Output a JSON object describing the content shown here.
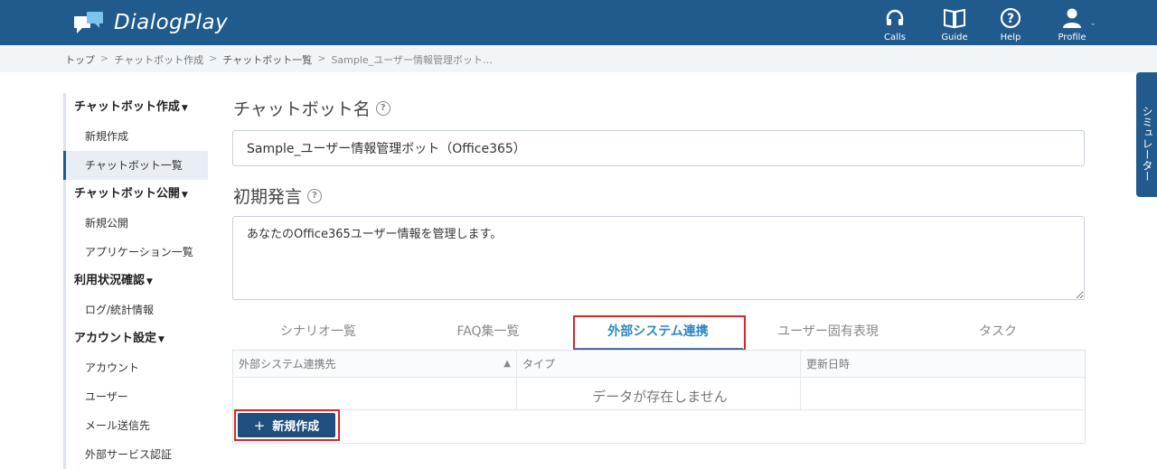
{
  "header": {
    "app_name": "DialogPlay",
    "nav": [
      {
        "id": "calls",
        "label": "Calls",
        "icon": "headset-icon"
      },
      {
        "id": "guide",
        "label": "Guide",
        "icon": "book-icon"
      },
      {
        "id": "help",
        "label": "Help",
        "icon": "question-icon"
      },
      {
        "id": "profile",
        "label": "Profile",
        "icon": "user-icon"
      }
    ],
    "profile_caret": "⌄"
  },
  "breadcrumb": {
    "items": [
      "トップ",
      "チャットボット作成",
      "チャットボット一覧",
      "Sample_ユーザー情報管理ボット…"
    ],
    "separator": ">"
  },
  "sidebar": {
    "groups": [
      {
        "title": "チャットボット作成",
        "items": [
          "新規作成",
          "チャットボット一覧"
        ]
      },
      {
        "title": "チャットボット公開",
        "items": [
          "新規公開",
          "アプリケーション一覧"
        ]
      },
      {
        "title": "利用状況確認",
        "items": [
          "ログ/統計情報"
        ]
      },
      {
        "title": "アカウント設定",
        "items": [
          "アカウント",
          "ユーザー",
          "メール送信先",
          "外部サービス認証"
        ]
      }
    ],
    "active_item": "チャットボット一覧"
  },
  "form": {
    "name_label": "チャットボット名",
    "name_value": "Sample_ユーザー情報管理ボット（Office365）",
    "greeting_label": "初期発言",
    "greeting_value": "あなたのOffice365ユーザー情報を管理します。",
    "help_glyph": "?"
  },
  "tabs": {
    "items": [
      "シナリオ一覧",
      "FAQ集一覧",
      "外部システム連携",
      "ユーザー固有表現",
      "タスク"
    ],
    "active_index": 2
  },
  "table": {
    "columns": [
      "外部システム連携先",
      "タイプ",
      "更新日時"
    ],
    "sort_indicator": "▲",
    "empty_message": "データが存在しません"
  },
  "actions": {
    "new_button_plus": "+",
    "new_button_label": "新規作成"
  },
  "simulator": {
    "label": "シミュレーター"
  },
  "colors": {
    "header_bg": "#215a8c",
    "active_tab": "#2e86c1",
    "button_bg": "#1f4f7c",
    "highlight": "#d9262b"
  }
}
